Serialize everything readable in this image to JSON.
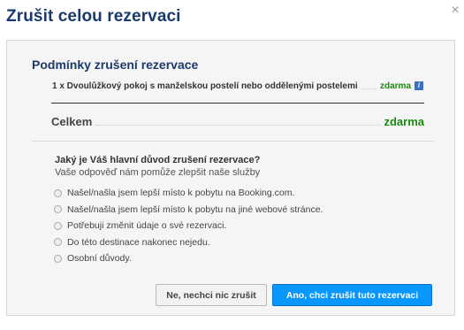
{
  "dialog": {
    "title": "Zrušit celou rezervaci",
    "close_icon": "close-icon"
  },
  "conditions": {
    "title": "Podmínky zrušení rezervace",
    "room_line": "1 x Dvoulůžkový pokoj s manželskou postelí nebo oddělenými postelemi",
    "room_price": "zdarma",
    "info_icon": "info-icon",
    "total_label": "Celkem",
    "total_price": "zdarma"
  },
  "reason": {
    "question": "Jaký je Váš hlavní důvod zrušení rezervace?",
    "subtext": "Vaše odpověď nám pomůže zlepšit naše služby",
    "options": [
      "Našel/našla jsem lepší místo k pobytu na Booking.com.",
      "Našel/našla jsem lepší místo k pobytu na jiné webové stránce.",
      "Potřebuji změnit údaje o své rezervaci.",
      "Do této destinace nakonec nejedu.",
      "Osobní důvody."
    ]
  },
  "buttons": {
    "cancel_label": "Ne, nechci nic zrušit",
    "confirm_label": "Ano, chci zrušit tuto rezervaci"
  },
  "colors": {
    "title": "#1b3a6b",
    "free_green": "#188a10",
    "primary_button": "#0896ff"
  }
}
